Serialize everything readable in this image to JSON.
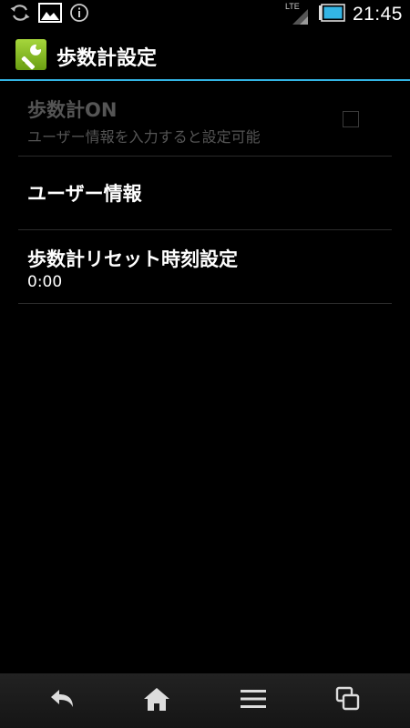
{
  "status_bar": {
    "network_label": "LTE",
    "time": "21:45",
    "icons": [
      "sync-icon",
      "image-icon",
      "info-icon",
      "signal-icon",
      "battery-icon"
    ]
  },
  "action_bar": {
    "title": "歩数計設定",
    "app_icon": "wrench-icon",
    "accent_color": "#33b5e5"
  },
  "preferences": {
    "pedometer_on": {
      "title": "歩数計ON",
      "summary": "ユーザー情報を入力すると設定可能",
      "checked": false,
      "enabled": false
    },
    "user_info": {
      "title": "ユーザー情報"
    },
    "reset_time": {
      "title": "歩数計リセット時刻設定",
      "summary": "0:00"
    }
  },
  "nav_bar": {
    "buttons": [
      "back-icon",
      "home-icon",
      "menu-icon",
      "recent-apps-icon"
    ]
  }
}
